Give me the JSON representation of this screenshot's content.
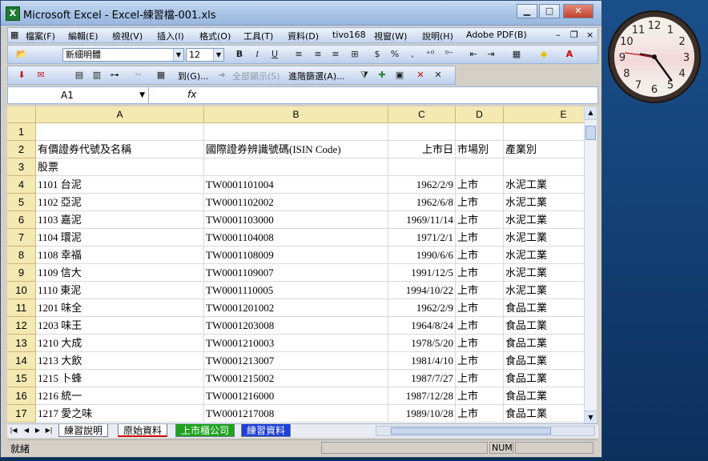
{
  "window": {
    "title": "Microsoft Excel - Excel-練習檔-001.xls",
    "app_icon": "X"
  },
  "menu": {
    "items": [
      "檔案(F)",
      "編輯(E)",
      "檢視(V)",
      "插入(I)",
      "格式(O)",
      "工具(T)",
      "資料(D)",
      "tivo168",
      "視窗(W)",
      "說明(H)",
      "Adobe PDF(B)"
    ],
    "close_label": "×"
  },
  "format_toolbar": {
    "font_name": "新細明體",
    "font_size": "12",
    "bold": "B",
    "italic": "I",
    "underline": "U",
    "currency": "$",
    "percent": "%"
  },
  "filter_toolbar": {
    "goto": "到(G)...",
    "show_all": "全部顯示(S)",
    "advanced": "進階篩選(A)..."
  },
  "formula_bar": {
    "name_box": "A1",
    "fx": "fx",
    "value": ""
  },
  "columns": [
    "A",
    "B",
    "C",
    "D",
    "E"
  ],
  "rows": [
    {
      "n": "1",
      "a": "",
      "b": "",
      "c": "",
      "d": "",
      "e": ""
    },
    {
      "n": "2",
      "a": "有價證券代號及名稱",
      "b": "國際證券辨識號碼(ISIN Code)",
      "c": "上市日",
      "d": "市場別",
      "e": "產業別"
    },
    {
      "n": "3",
      "a": "股票",
      "b": "",
      "c": "",
      "d": "",
      "e": ""
    },
    {
      "n": "4",
      "a": "1101  台泥",
      "b": "TW0001101004",
      "c": "1962/2/9",
      "d": "上市",
      "e": "水泥工業"
    },
    {
      "n": "5",
      "a": "1102  亞泥",
      "b": "TW0001102002",
      "c": "1962/6/8",
      "d": "上市",
      "e": "水泥工業"
    },
    {
      "n": "6",
      "a": "1103  嘉泥",
      "b": "TW0001103000",
      "c": "1969/11/14",
      "d": "上市",
      "e": "水泥工業"
    },
    {
      "n": "7",
      "a": "1104  環泥",
      "b": "TW0001104008",
      "c": "1971/2/1",
      "d": "上市",
      "e": "水泥工業"
    },
    {
      "n": "8",
      "a": "1108  幸福",
      "b": "TW0001108009",
      "c": "1990/6/6",
      "d": "上市",
      "e": "水泥工業"
    },
    {
      "n": "9",
      "a": "1109  信大",
      "b": "TW0001109007",
      "c": "1991/12/5",
      "d": "上市",
      "e": "水泥工業"
    },
    {
      "n": "10",
      "a": "1110  東泥",
      "b": "TW0001110005",
      "c": "1994/10/22",
      "d": "上市",
      "e": "水泥工業"
    },
    {
      "n": "11",
      "a": "1201  味全",
      "b": "TW0001201002",
      "c": "1962/2/9",
      "d": "上市",
      "e": "食品工業"
    },
    {
      "n": "12",
      "a": "1203  味王",
      "b": "TW0001203008",
      "c": "1964/8/24",
      "d": "上市",
      "e": "食品工業"
    },
    {
      "n": "13",
      "a": "1210  大成",
      "b": "TW0001210003",
      "c": "1978/5/20",
      "d": "上市",
      "e": "食品工業"
    },
    {
      "n": "14",
      "a": "1213  大飲",
      "b": "TW0001213007",
      "c": "1981/4/10",
      "d": "上市",
      "e": "食品工業"
    },
    {
      "n": "15",
      "a": "1215  卜蜂",
      "b": "TW0001215002",
      "c": "1987/7/27",
      "d": "上市",
      "e": "食品工業"
    },
    {
      "n": "16",
      "a": "1216  統一",
      "b": "TW0001216000",
      "c": "1987/12/28",
      "d": "上市",
      "e": "食品工業"
    },
    {
      "n": "17",
      "a": "1217  愛之味",
      "b": "TW0001217008",
      "c": "1989/10/28",
      "d": "上市",
      "e": "食品工業"
    }
  ],
  "sheet_tabs": [
    {
      "label": "練習說明",
      "color": "#ffffff"
    },
    {
      "label": "原始資料",
      "color": "#ffffff"
    },
    {
      "label": "上市櫃公司",
      "color": "#1fa31f"
    },
    {
      "label": "練習資料",
      "color": "#1f3fd6"
    }
  ],
  "status": {
    "left": "就緒",
    "num": "NUM"
  },
  "clock": {
    "numbers": [
      "12",
      "1",
      "2",
      "3",
      "4",
      "5",
      "6",
      "7",
      "8",
      "9",
      "10",
      "11"
    ]
  }
}
